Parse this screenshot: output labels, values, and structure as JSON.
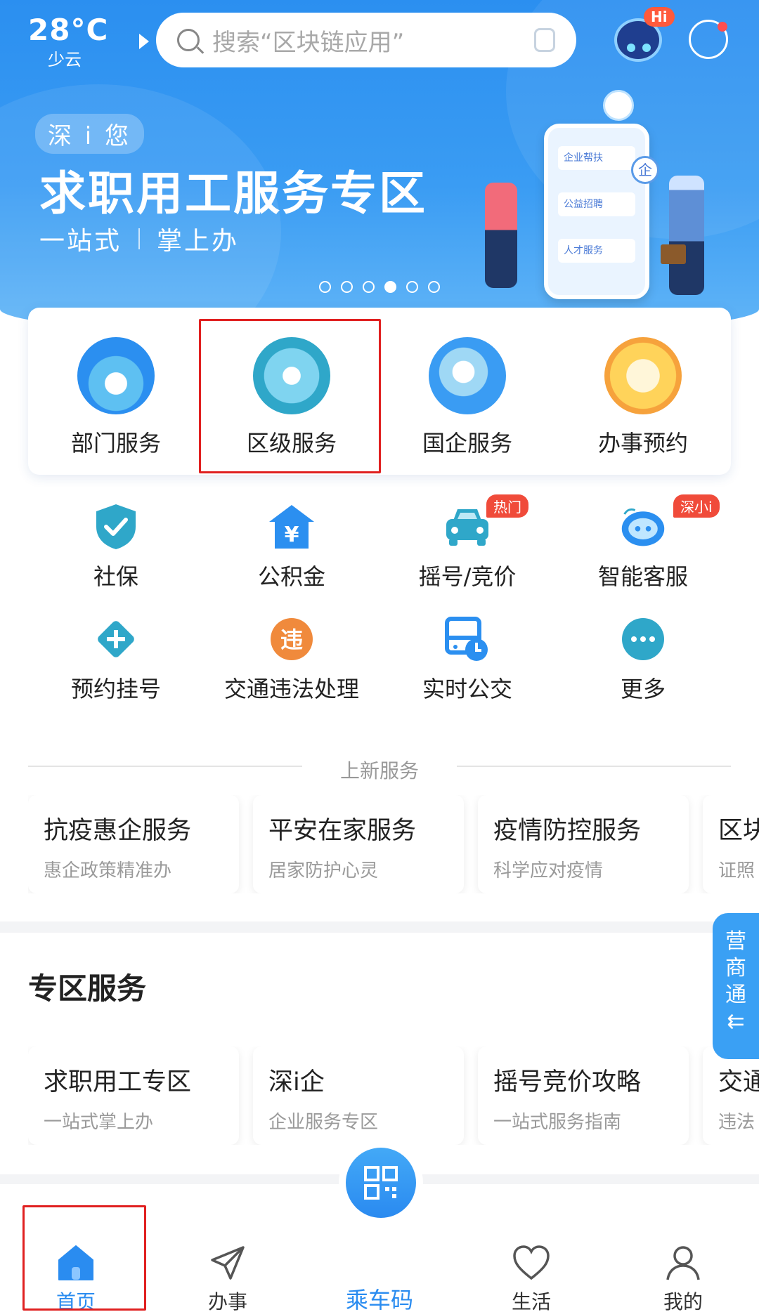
{
  "header": {
    "temperature": "28°C",
    "weather": "少云",
    "search_placeholder": "搜索“区块链应用”",
    "robot_badge": "Hi"
  },
  "banner": {
    "tag": "深 i 您",
    "title": "求职用工服务专区",
    "sub_left": "一站式",
    "sub_right": "掌上办",
    "illus_cards": [
      "企业帮扶",
      "公益招聘",
      "人才服务"
    ],
    "illus_badge": "企",
    "page_dots": 6,
    "active_dot": 3
  },
  "main_services": [
    {
      "label": "部门服务",
      "icon": "department-icon"
    },
    {
      "label": "区级服务",
      "icon": "district-icon"
    },
    {
      "label": "国企服务",
      "icon": "state-enterprise-icon"
    },
    {
      "label": "办事预约",
      "icon": "appointment-icon"
    }
  ],
  "grid_services": [
    {
      "label": "社保",
      "icon": "shield-icon"
    },
    {
      "label": "公积金",
      "icon": "house-fund-icon",
      "glyph": "¥"
    },
    {
      "label": "摇号/竞价",
      "icon": "car-icon",
      "badge": "热门"
    },
    {
      "label": "智能客服",
      "icon": "chatbot-icon",
      "badge": "深小i"
    },
    {
      "label": "预约挂号",
      "icon": "medical-cross-icon"
    },
    {
      "label": "交通违法处理",
      "icon": "traffic-violation-icon",
      "glyph": "违"
    },
    {
      "label": "实时公交",
      "icon": "bus-clock-icon"
    },
    {
      "label": "更多",
      "icon": "more-icon"
    }
  ],
  "new_services": {
    "heading": "上新服务",
    "cards": [
      {
        "title": "抗疫惠企服务",
        "subtitle": "惠企政策精准办"
      },
      {
        "title": "平安在家服务",
        "subtitle": "居家防护心灵"
      },
      {
        "title": "疫情防控服务",
        "subtitle": "科学应对疫情"
      },
      {
        "title": "区块",
        "subtitle": "证照"
      }
    ]
  },
  "zone": {
    "heading": "专区服务",
    "cards": [
      {
        "title": "求职用工专区",
        "subtitle": "一站式掌上办"
      },
      {
        "title": "深i企",
        "subtitle": "企业服务专区"
      },
      {
        "title": "摇号竞价攻略",
        "subtitle": "一站式服务指南"
      },
      {
        "title": "交通",
        "subtitle": "违法"
      }
    ]
  },
  "side_tab": {
    "chars": [
      "营",
      "商",
      "通"
    ],
    "arrow": "⇇"
  },
  "bottom_nav": [
    {
      "label": "首页",
      "icon": "home-icon",
      "active": true
    },
    {
      "label": "办事",
      "icon": "send-icon"
    },
    {
      "label": "乘车码",
      "icon": "qr-code-icon"
    },
    {
      "label": "生活",
      "icon": "heart-icon"
    },
    {
      "label": "我的",
      "icon": "profile-icon"
    }
  ],
  "colors": {
    "primary": "#2a8cf0",
    "highlight_box": "#e02020",
    "badge_red": "#f04b3a",
    "teal_icon": "#2fa7c9",
    "orange_icon": "#f08a3c"
  }
}
